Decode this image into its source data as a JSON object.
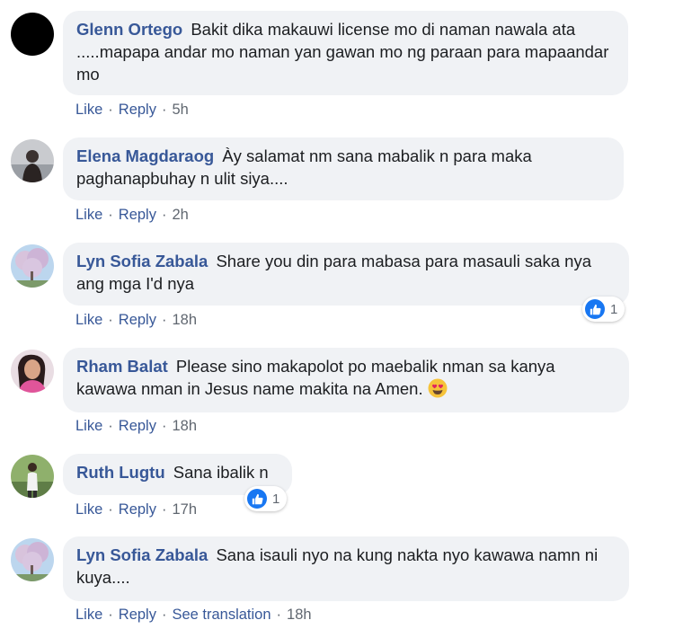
{
  "comments": [
    {
      "author": "Glenn Ortego",
      "text": "Bakit dika makauwi license mo di naman nawala ata .....mapapa andar mo naman yan gawan mo ng paraan para mapaandar mo",
      "actions": {
        "like": "Like",
        "reply": "Reply",
        "time": "5h"
      }
    },
    {
      "author": "Elena Magdaraog",
      "text": "Ày salamat nm sana mabalik n para maka paghanapbuhay n ulit siya....",
      "actions": {
        "like": "Like",
        "reply": "Reply",
        "time": "2h"
      }
    },
    {
      "author": "Lyn Sofia Zabala",
      "text": "Share you din para mabasa para masauli saka nya ang mga I'd nya",
      "actions": {
        "like": "Like",
        "reply": "Reply",
        "time": "18h"
      },
      "reactions": {
        "icon": "like-icon",
        "count": "1"
      }
    },
    {
      "author": "Rham Balat",
      "text": "Please sino makapolot po maebalik nman sa kanya kawawa nman in Jesus name makita na Amen.",
      "emoji": "heart-eyes-emoji",
      "actions": {
        "like": "Like",
        "reply": "Reply",
        "time": "18h"
      }
    },
    {
      "author": "Ruth Lugtu",
      "text": "Sana ibalik n",
      "actions": {
        "like": "Like",
        "reply": "Reply",
        "time": "17h"
      },
      "reactions": {
        "icon": "like-icon",
        "count": "1"
      }
    },
    {
      "author": "Lyn Sofia Zabala",
      "text": "Sana isauli nyo na kung nakta nyo kawawa namn ni kuya....",
      "actions": {
        "like": "Like",
        "reply": "Reply",
        "see_translation": "See translation",
        "time": "18h"
      }
    }
  ],
  "colors": {
    "author": "#385898",
    "bubble": "#f0f2f5",
    "like_badge": "#1877f2",
    "meta": "#606770"
  }
}
